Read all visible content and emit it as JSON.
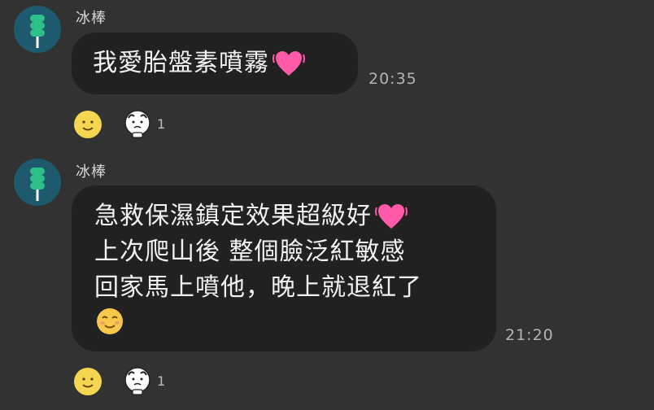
{
  "messages": [
    {
      "sender": "冰棒",
      "lines": [
        "我愛胎盤素噴霧"
      ],
      "emoji_after": "heart-icon",
      "time": "20:35",
      "reaction_count": "1"
    },
    {
      "sender": "冰棒",
      "lines": [
        "急救保濕鎮定效果超級好",
        "上次爬山後 整個臉泛紅敏感",
        "回家馬上噴他，晚上就退紅了"
      ],
      "emoji_after": "smiling-face-icon",
      "time": "21:20",
      "reaction_count": "1"
    }
  ],
  "colors": {
    "background": "#323232",
    "bubble": "#212121",
    "avatar_bg": "#1e5a6e",
    "popsicle": "#2fbf88",
    "heart": "#ff5aa8"
  }
}
